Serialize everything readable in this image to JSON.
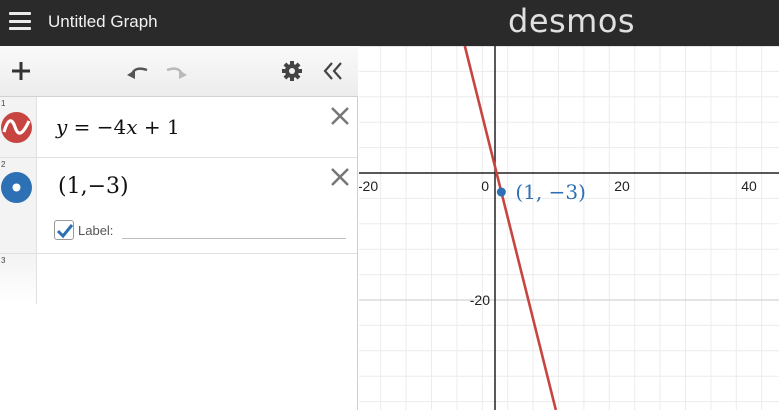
{
  "app": {
    "title": "Untitled Graph",
    "logo": "desmos",
    "menu_icon": "hamburger-icon"
  },
  "toolbar": {
    "add_icon": "plus-icon",
    "undo_icon": "undo-icon",
    "redo_icon": "redo-icon",
    "settings_icon": "gear-icon",
    "collapse_icon": "double-chevron-left-icon"
  },
  "expressions": [
    {
      "num": "1",
      "icon": "curve-icon",
      "color": "#c74440",
      "parts": {
        "y": "y",
        "eq": " = −4",
        "x": "x",
        "rest": " + 1"
      }
    },
    {
      "num": "2",
      "icon": "point-icon",
      "color": "#2d70b3",
      "text": "(1,−3)",
      "label_checked": true,
      "label_caption": "Label:",
      "label_value": ""
    },
    {
      "num": "3"
    }
  ],
  "graph": {
    "x_ticks": [
      "-20",
      "0",
      "20",
      "40"
    ],
    "y_ticks": [
      "-20"
    ],
    "point_label": "(1, −3)",
    "line_color": "#c74440",
    "point_color": "#2d70b3"
  },
  "colors": {
    "topbar": "#2a2a2a",
    "axis": "#222222",
    "major_grid": "#c8c8c8",
    "minor_grid": "#ececec"
  }
}
